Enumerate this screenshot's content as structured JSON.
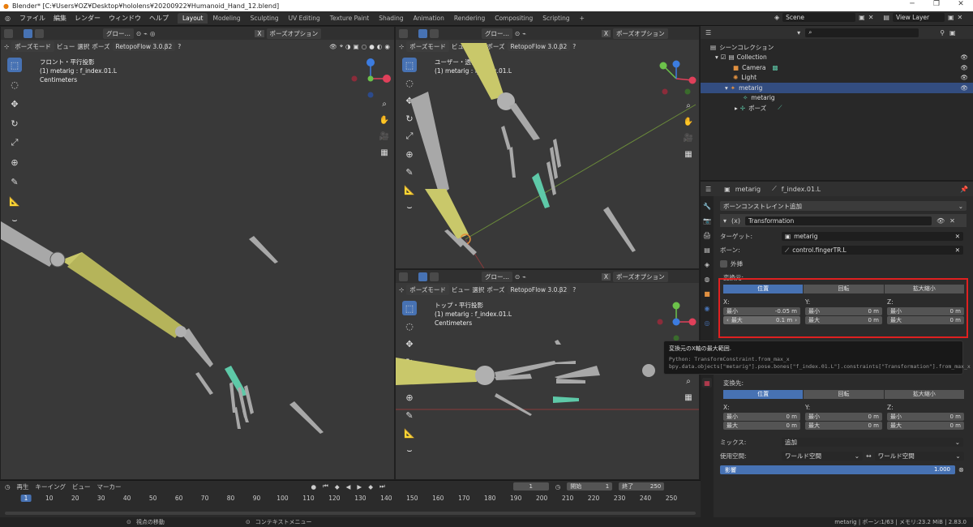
{
  "window": {
    "title": "Blender* [C:¥Users¥OZ¥Desktop¥hololens¥20200922¥Humanoid_Hand_12.blend]"
  },
  "menu": [
    "ファイル",
    "編集",
    "レンダー",
    "ウィンドウ",
    "ヘルプ"
  ],
  "workspaces": [
    "Layout",
    "Modeling",
    "Sculpting",
    "UV Editing",
    "Texture Paint",
    "Shading",
    "Animation",
    "Rendering",
    "Compositing",
    "Scripting"
  ],
  "scene": {
    "name": "Scene",
    "view_layer": "View Layer"
  },
  "viewport_header": {
    "mode": "ポーズモード",
    "view": "ビュー",
    "select": "選択",
    "pose": "ポーズ",
    "addon": "RetopoFlow 3.0.β2",
    "transform": "グロー…",
    "options": "ポーズオプション",
    "x_toggle": "X"
  },
  "viewports": {
    "front": {
      "line1": "フロント・平行投影",
      "line2": "(1) metarig : f_index.01.L",
      "line3": "Centimeters"
    },
    "user": {
      "line1": "ユーザー・透視投影",
      "line2": "(1) metarig : f_index.01.L"
    },
    "top": {
      "line1": "トップ・平行投影",
      "line2": "(1) metarig : f_index.01.L",
      "line3": "Centimeters"
    }
  },
  "outliner": {
    "root": "シーンコレクション",
    "items": [
      {
        "label": "Collection",
        "indent": 1
      },
      {
        "label": "Camera",
        "indent": 2
      },
      {
        "label": "Light",
        "indent": 2
      },
      {
        "label": "metarig",
        "indent": 2
      },
      {
        "label": "metarig",
        "indent": 3
      },
      {
        "label": "ポーズ",
        "indent": 3
      }
    ]
  },
  "properties": {
    "breadcrumb_object": "metarig",
    "breadcrumb_bone": "f_index.01.L",
    "add_constraint": "ボーンコンストレイント追加",
    "constraint_name": "Transformation",
    "target_label": "ターゲット:",
    "target_value": "metarig",
    "bone_label": "ボーン:",
    "bone_value": "control.fingerTR.L",
    "extrapolate_label": "外挿",
    "map_from_label": "変換元:",
    "map_from_tabs": [
      "位置",
      "回転",
      "拡大縮小"
    ],
    "axis_x": "X:",
    "axis_y": "Y:",
    "axis_z": "Z:",
    "min_label": "最小",
    "max_label": "最大",
    "from_x_min": "-0.05 m",
    "from_x_max": "0.1 m",
    "from_y_min": "0 m",
    "from_y_max": "0 m",
    "from_z_min": "0 m",
    "from_z_max": "0 m",
    "map_axis_label": "Z",
    "map_to_label": "変換先:",
    "map_to_tabs": [
      "位置",
      "回転",
      "拡大縮小"
    ],
    "to_x_min": "0 m",
    "to_x_max": "0 m",
    "to_y_min": "0 m",
    "to_y_max": "0 m",
    "to_z_min": "0 m",
    "to_z_max": "0 m",
    "mix_label": "ミックス:",
    "mix_value": "追加",
    "space_label": "使用空間:",
    "owner_space": "ワールド空間",
    "target_space": "ワールド空間",
    "influence_label": "影響",
    "influence_value": "1.000",
    "influence_fraction": 1.0
  },
  "tooltip": {
    "title": "変換元のX軸の最大範囲.",
    "python1": "Python: TransformConstraint.from_max_x",
    "python2": "bpy.data.objects[\"metarig\"].pose.bones[\"f_index.01.L\"].constraints[\"Transformation\"].from_max_x"
  },
  "timeline": {
    "playback": "再生",
    "keying": "キーイング",
    "view": "ビュー",
    "marker": "マーカー",
    "current_frame": "1",
    "start_label": "開始",
    "start": "1",
    "end_label": "終了",
    "end": "250",
    "ticks": [
      "1",
      "10",
      "20",
      "30",
      "40",
      "50",
      "60",
      "70",
      "80",
      "90",
      "100",
      "110",
      "120",
      "130",
      "140",
      "150",
      "160",
      "170",
      "180",
      "190",
      "200",
      "210",
      "220",
      "230",
      "240",
      "250"
    ]
  },
  "status": {
    "left": "視点の移動",
    "middle": "コンテキストメニュー",
    "right": "metarig | ボーン:1/63 | メモリ:23.2 MiB | 2.83.0"
  },
  "colors": {
    "accent": "#4772b3",
    "highlight": "#e02020",
    "bone_yellow": "#c9c86a",
    "bone_gray": "#a8a8a8",
    "bone_teal": "#5ec9a8"
  }
}
